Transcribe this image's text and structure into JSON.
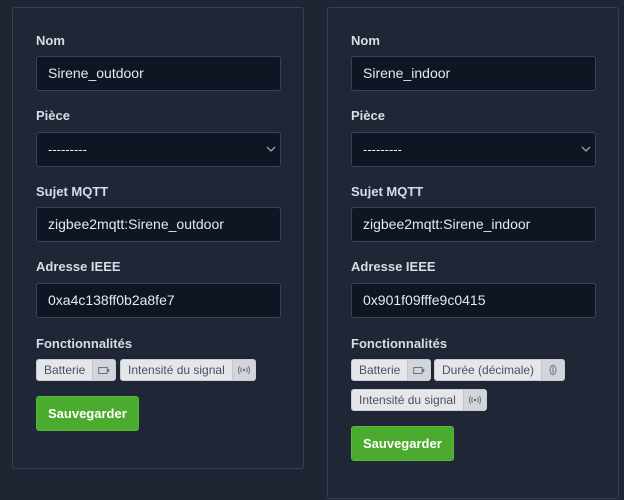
{
  "devices": [
    {
      "name_label": "Nom",
      "name_value": "Sirene_outdoor",
      "room_label": "Pièce",
      "room_value": "---------",
      "mqtt_label": "Sujet MQTT",
      "mqtt_value": "zigbee2mqtt:Sirene_outdoor",
      "ieee_label": "Adresse IEEE",
      "ieee_value": "0xa4c138ff0b2a8fe7",
      "features_label": "Fonctionnalités",
      "features": [
        {
          "label": "Batterie",
          "icon": "battery-icon"
        },
        {
          "label": "Intensité du signal",
          "icon": "signal-icon"
        }
      ],
      "save_label": "Sauvegarder"
    },
    {
      "name_label": "Nom",
      "name_value": "Sirene_indoor",
      "room_label": "Pièce",
      "room_value": "---------",
      "mqtt_label": "Sujet MQTT",
      "mqtt_value": "zigbee2mqtt:Sirene_indoor",
      "ieee_label": "Adresse IEEE",
      "ieee_value": "0x901f09fffe9c0415",
      "features_label": "Fonctionnalités",
      "features": [
        {
          "label": "Batterie",
          "icon": "battery-icon"
        },
        {
          "label": "Durée (décimale)",
          "icon": "duration-icon"
        },
        {
          "label": "Intensité du signal",
          "icon": "signal-icon"
        }
      ],
      "save_label": "Sauvegarder"
    }
  ],
  "colors": {
    "page_background": "#1e2533",
    "input_background": "#0f1523",
    "save_button": "#4aab2e",
    "tag_background": "#e4e6ea"
  }
}
